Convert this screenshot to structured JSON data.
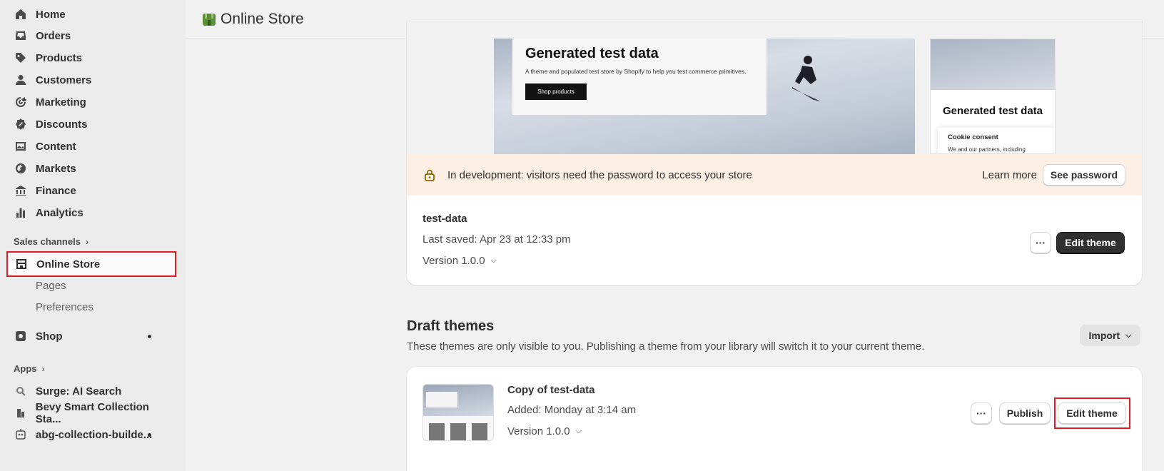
{
  "sidebar": {
    "items": [
      {
        "label": "Home",
        "icon": "home-icon"
      },
      {
        "label": "Orders",
        "icon": "inbox-icon"
      },
      {
        "label": "Products",
        "icon": "tag-icon"
      },
      {
        "label": "Customers",
        "icon": "person-icon"
      },
      {
        "label": "Marketing",
        "icon": "target-icon"
      },
      {
        "label": "Discounts",
        "icon": "discount-icon"
      },
      {
        "label": "Content",
        "icon": "image-icon"
      },
      {
        "label": "Markets",
        "icon": "globe-icon"
      },
      {
        "label": "Finance",
        "icon": "bank-icon"
      },
      {
        "label": "Analytics",
        "icon": "bar-chart-icon"
      }
    ],
    "sales_channels_label": "Sales channels",
    "online_store": {
      "label": "Online Store",
      "subitems": [
        "Pages",
        "Preferences"
      ]
    },
    "shop_label": "Shop",
    "apps_label": "Apps",
    "apps": [
      {
        "label": "Surge: AI Search"
      },
      {
        "label": "Bevy Smart Collection Sta..."
      },
      {
        "label": "abg-collection-builde..."
      }
    ]
  },
  "header": {
    "title": "Online Store"
  },
  "current_theme": {
    "preview": {
      "desktop_heading": "Generated test data",
      "desktop_text": "A theme and populated test store by Shopify to help you test commerce primitives.",
      "desktop_button": "Shop products",
      "mobile_heading": "Generated test data",
      "cookie_title": "Cookie consent",
      "cookie_text": "We and our partners, including"
    },
    "banner": {
      "message": "In development: visitors need the password to access your store",
      "learn_more": "Learn more",
      "see_password": "See password"
    },
    "name": "test-data",
    "last_saved": "Last saved: Apr 23 at 12:33 pm",
    "version": "Version 1.0.0",
    "edit_label": "Edit theme",
    "more_label": "···"
  },
  "draft": {
    "title": "Draft themes",
    "subtitle": "These themes are only visible to you. Publishing a theme from your library will switch it to your current theme.",
    "import_label": "Import",
    "theme": {
      "name": "Copy of test-data",
      "added": "Added: Monday at 3:14 am",
      "version": "Version 1.0.0",
      "publish_label": "Publish",
      "edit_label": "Edit theme",
      "more_label": "···"
    }
  }
}
